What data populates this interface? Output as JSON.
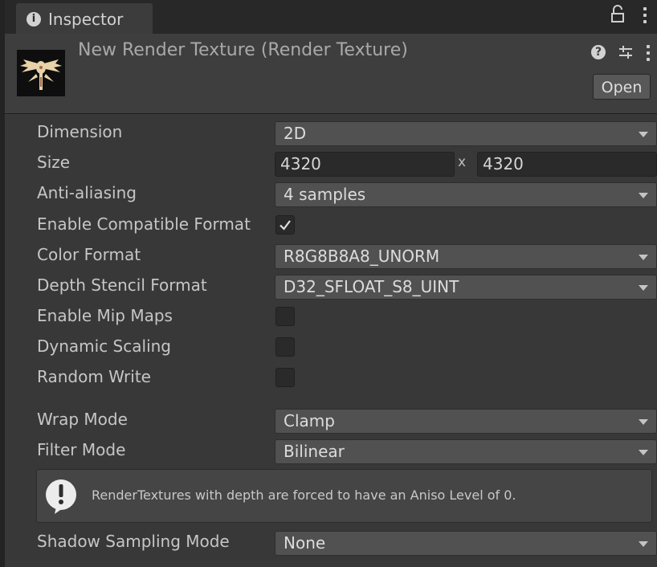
{
  "tab": {
    "title": "Inspector",
    "icon": "info-icon"
  },
  "tab_actions": [
    "lock-icon",
    "kebab-menu-icon"
  ],
  "header": {
    "title": "New Render Texture (Render Texture)",
    "open_label": "Open",
    "icons": [
      "help-icon",
      "presets-icon",
      "kebab-menu-icon"
    ]
  },
  "fields": {
    "dimension": {
      "label": "Dimension",
      "value": "2D"
    },
    "size": {
      "label": "Size",
      "width": "4320",
      "separator": "x",
      "height": "4320"
    },
    "anti_aliasing": {
      "label": "Anti-aliasing",
      "value": "4 samples"
    },
    "enable_compatible_format": {
      "label": "Enable Compatible Format",
      "checked": true
    },
    "color_format": {
      "label": "Color Format",
      "value": "R8G8B8A8_UNORM"
    },
    "depth_stencil_format": {
      "label": "Depth Stencil Format",
      "value": "D32_SFLOAT_S8_UINT"
    },
    "enable_mip_maps": {
      "label": "Enable Mip Maps",
      "checked": false
    },
    "dynamic_scaling": {
      "label": "Dynamic Scaling",
      "checked": false
    },
    "random_write": {
      "label": "Random Write",
      "checked": false
    },
    "wrap_mode": {
      "label": "Wrap Mode",
      "value": "Clamp"
    },
    "filter_mode": {
      "label": "Filter Mode",
      "value": "Bilinear"
    },
    "shadow_sampling_mode": {
      "label": "Shadow Sampling Mode",
      "value": "None"
    }
  },
  "help_box": {
    "icon": "warning-icon",
    "text": "RenderTextures with depth are forced to have an Aniso Level of 0."
  },
  "colors": {
    "panel_bg": "#383838",
    "tab_bar_bg": "#282828",
    "dropdown_bg": "#515151",
    "field_bg": "#2a2a2a",
    "text": "#c4c4c4"
  }
}
